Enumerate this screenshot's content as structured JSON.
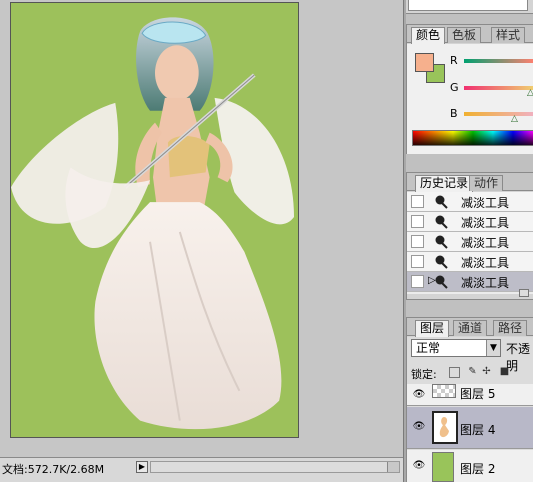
{
  "status": {
    "doc_info": "文档:572.7K/2.68M",
    "arrow": "▶"
  },
  "color_panel": {
    "tabs": [
      "颜色",
      "色板",
      "样式"
    ],
    "foreground": "#f6b08d",
    "background": "#99c45a",
    "channels": [
      {
        "label": "R"
      },
      {
        "label": "G"
      },
      {
        "label": "B"
      }
    ]
  },
  "history_panel": {
    "tabs": [
      "历史记录",
      "动作"
    ],
    "items": [
      {
        "label": "减淡工具"
      },
      {
        "label": "减淡工具"
      },
      {
        "label": "减淡工具"
      },
      {
        "label": "减淡工具"
      },
      {
        "label": "减淡工具"
      }
    ],
    "icon": "dodge-tool-icon"
  },
  "layers_panel": {
    "tabs": [
      "图层",
      "通道",
      "路径"
    ],
    "blend_mode": "正常",
    "opacity_label": "不透明",
    "lock_label": "锁定:",
    "layers": [
      {
        "name": "图层 5",
        "visible": true
      },
      {
        "name": "图层 4",
        "visible": true
      },
      {
        "name": "图层 2",
        "visible": true
      }
    ]
  },
  "canvas": {
    "background_color": "#9dc15b"
  }
}
